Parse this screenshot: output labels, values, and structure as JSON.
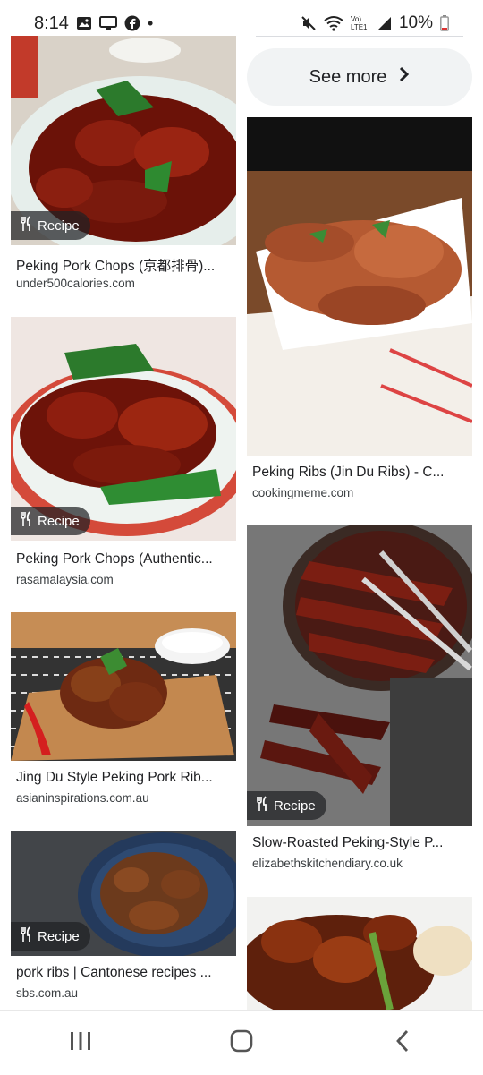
{
  "status_bar": {
    "time": "8:14",
    "network_label": "Vo) LTE1",
    "battery": "10%",
    "icons": [
      "image-icon",
      "screen-icon",
      "facebook-icon",
      "dot-icon",
      "mute-icon",
      "wifi-icon",
      "signal-icon",
      "battery-icon"
    ]
  },
  "see_more": {
    "label": "See more"
  },
  "results": [
    {
      "title": "Peking Pork Chops (京都排骨)...",
      "source": "under500calories.com",
      "badge": "Recipe"
    },
    {
      "title": "Peking Pork Chops (Authentic...",
      "source": "rasamalaysia.com",
      "badge": "Recipe"
    },
    {
      "title": "Jing Du Style Peking Pork Rib...",
      "source": "asianinspirations.com.au",
      "badge": ""
    },
    {
      "title": "pork ribs | Cantonese recipes ...",
      "source": "sbs.com.au",
      "badge": "Recipe"
    },
    {
      "title": "Peking Ribs (Jin Du Ribs) - C...",
      "source": "cookingmeme.com",
      "badge": ""
    },
    {
      "title": "Slow-Roasted Peking-Style P...",
      "source": "elizabethskitchendiary.co.uk",
      "badge": "Recipe"
    },
    {
      "title": "",
      "source": "",
      "badge": ""
    }
  ],
  "nav": {
    "icons": [
      "recent-apps-icon",
      "home-icon",
      "back-icon"
    ]
  },
  "colors": {
    "badge_bg": "#202124",
    "chip_bg": "#f1f3f4",
    "meat": "#8b1a10",
    "plate": "#e8f0ef"
  }
}
